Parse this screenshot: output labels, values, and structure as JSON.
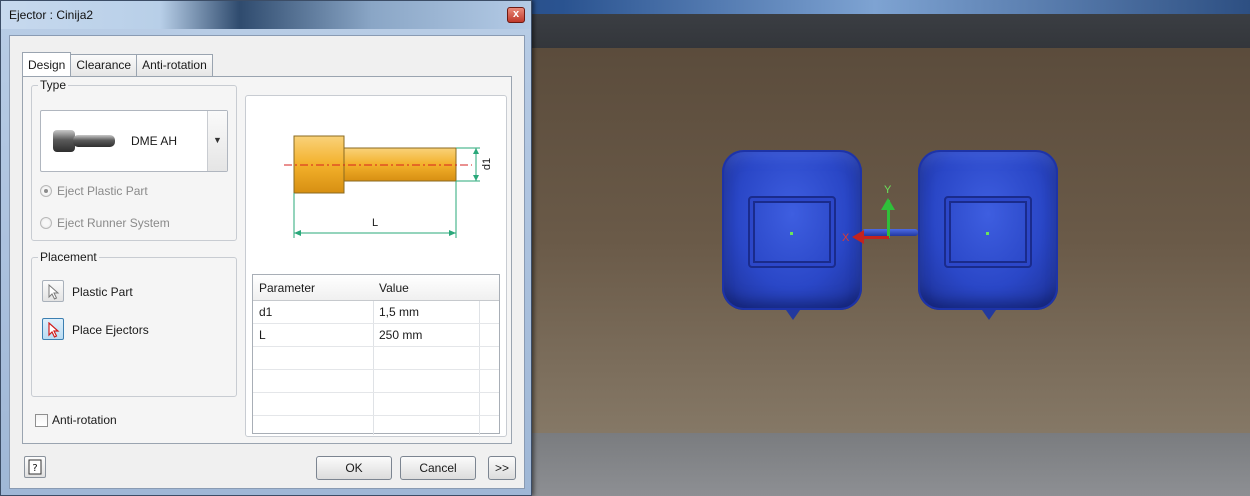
{
  "dialog": {
    "title": "Ejector : Cinija2",
    "close_glyph": "x",
    "tabs": [
      {
        "label": "Design",
        "active": true
      },
      {
        "label": "Clearance",
        "active": false
      },
      {
        "label": "Anti-rotation",
        "active": false
      }
    ],
    "type_group": {
      "label": "Type",
      "selected_type": "DME AH",
      "dropdown_icon": "chevron-down-icon",
      "options": [
        {
          "label": "Eject Plastic Part",
          "checked": true,
          "enabled": false
        },
        {
          "label": "Eject Runner System",
          "checked": false,
          "enabled": false
        }
      ]
    },
    "placement_group": {
      "label": "Placement",
      "plastic_part_label": "Plastic Part",
      "place_ejectors_label": "Place Ejectors"
    },
    "anti_rotation_label": "Anti-rotation",
    "diagram": {
      "diameter_label": "d1",
      "length_label": "L",
      "pin_color": "#f3b12b"
    },
    "param_table": {
      "headers": [
        "Parameter",
        "Value"
      ],
      "rows": [
        {
          "parameter": "d1",
          "value": "1,5 mm"
        },
        {
          "parameter": "L",
          "value": "250 mm"
        },
        {
          "parameter": "",
          "value": ""
        },
        {
          "parameter": "",
          "value": ""
        },
        {
          "parameter": "",
          "value": ""
        }
      ]
    },
    "buttons": {
      "ok": "OK",
      "cancel": "Cancel",
      "more": ">>"
    }
  },
  "viewport": {
    "axis_y_label": "Y",
    "axis_x_label": "X",
    "part_color": "#2a47c7",
    "background_color": "#6a5a48"
  }
}
